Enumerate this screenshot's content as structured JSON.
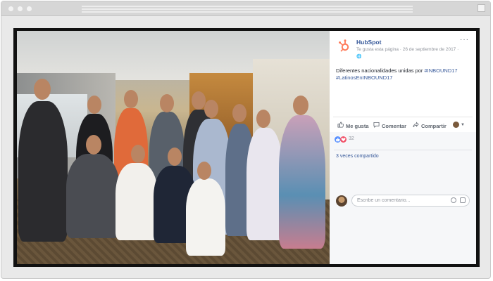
{
  "post": {
    "page_name": "HubSpot",
    "page_meta": "Te gusta esta página · 26 de septiembre de 2017 ·",
    "globe_glyph": "🌐",
    "more_label": "···",
    "text_before_tags": "Diferentes nacionalidades unidas por ",
    "hashtag_1": "#INBOUND17",
    "hashtag_2": "#LatinosEnINBOUND17",
    "brand_color": "#ff7a59"
  },
  "actions": {
    "like_label": "Me gusta",
    "comment_label": "Comentar",
    "share_label": "Compartir",
    "like_icon": "thumbs-up-icon",
    "comment_icon": "speech-bubble-icon",
    "share_icon": "share-arrow-icon"
  },
  "reactions": {
    "count": "32",
    "types": [
      "like",
      "love"
    ],
    "like_color": "#5890ff",
    "love_color": "#f25268"
  },
  "shares": {
    "label": "3 veces compartido"
  },
  "comment_input": {
    "placeholder": "Escribe un comentario...",
    "value": ""
  }
}
